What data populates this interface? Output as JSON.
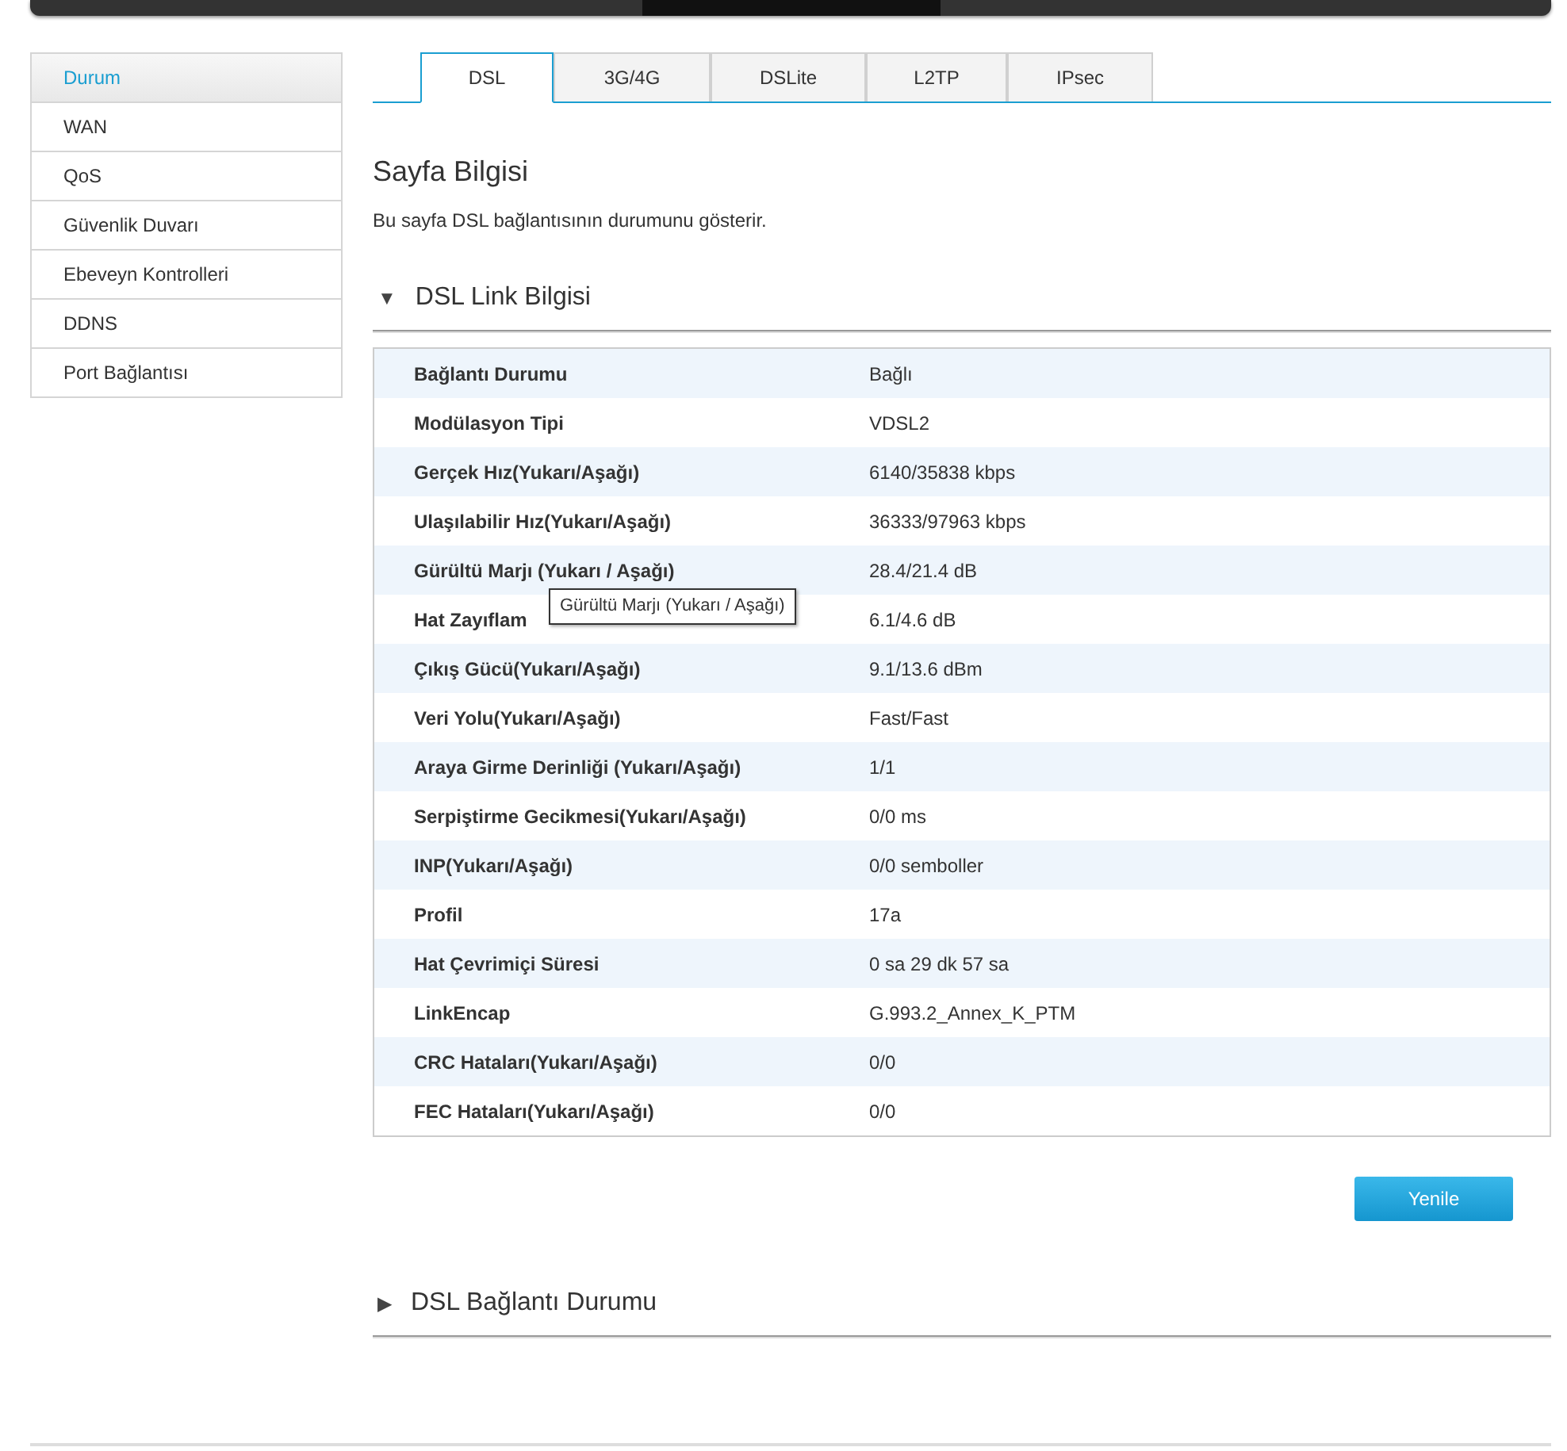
{
  "sidebar": {
    "items": [
      {
        "label": "Durum",
        "selected": true
      },
      {
        "label": "WAN",
        "selected": false
      },
      {
        "label": "QoS",
        "selected": false
      },
      {
        "label": "Güvenlik Duvarı",
        "selected": false
      },
      {
        "label": "Ebeveyn Kontrolleri",
        "selected": false
      },
      {
        "label": "DDNS",
        "selected": false
      },
      {
        "label": "Port Bağlantısı",
        "selected": false
      }
    ]
  },
  "tabs": [
    {
      "label": "DSL",
      "selected": true
    },
    {
      "label": "3G/4G",
      "selected": false
    },
    {
      "label": "DSLite",
      "selected": false
    },
    {
      "label": "L2TP",
      "selected": false
    },
    {
      "label": "IPsec",
      "selected": false
    }
  ],
  "page_info": {
    "title": "Sayfa Bilgisi",
    "description": "Bu sayfa DSL bağlantısının durumunu gösterir."
  },
  "sections": [
    {
      "toggle": "▼",
      "title": "DSL Link Bilgisi",
      "rows": [
        {
          "label": "Bağlantı Durumu",
          "value": "Bağlı"
        },
        {
          "label": "Modülasyon Tipi",
          "value": "VDSL2"
        },
        {
          "label": "Gerçek Hız(Yukarı/Aşağı)",
          "value": "6140/35838 kbps"
        },
        {
          "label": "Ulaşılabilir Hız(Yukarı/Aşağı)",
          "value": "36333/97963 kbps"
        },
        {
          "label": "Gürültü Marjı (Yukarı / Aşağı)",
          "value": "28.4/21.4 dB"
        },
        {
          "label": "Hat Zayıflam",
          "value": "6.1/4.6 dB"
        },
        {
          "label": "Çıkış Gücü(Yukarı/Aşağı)",
          "value": "9.1/13.6 dBm"
        },
        {
          "label": "Veri Yolu(Yukarı/Aşağı)",
          "value": "Fast/Fast"
        },
        {
          "label": "Araya Girme Derinliği (Yukarı/Aşağı)",
          "value": "1/1"
        },
        {
          "label": "Serpiştirme Gecikmesi(Yukarı/Aşağı)",
          "value": "0/0 ms"
        },
        {
          "label": "INP(Yukarı/Aşağı)",
          "value": "0/0 semboller"
        },
        {
          "label": "Profil",
          "value": "17a"
        },
        {
          "label": "Hat Çevrimiçi Süresi",
          "value": "0 sa 29 dk 57 sa"
        },
        {
          "label": "LinkEncap",
          "value": "G.993.2_Annex_K_PTM"
        },
        {
          "label": "CRC Hataları(Yukarı/Aşağı)",
          "value": "0/0"
        },
        {
          "label": "FEC Hataları(Yukarı/Aşağı)",
          "value": "0/0"
        }
      ],
      "tooltip": "Gürültü Marjı (Yukarı / Aşağı)",
      "button": "Yenile"
    },
    {
      "toggle": "▶",
      "title": "DSL Bağlantı Durumu"
    }
  ]
}
